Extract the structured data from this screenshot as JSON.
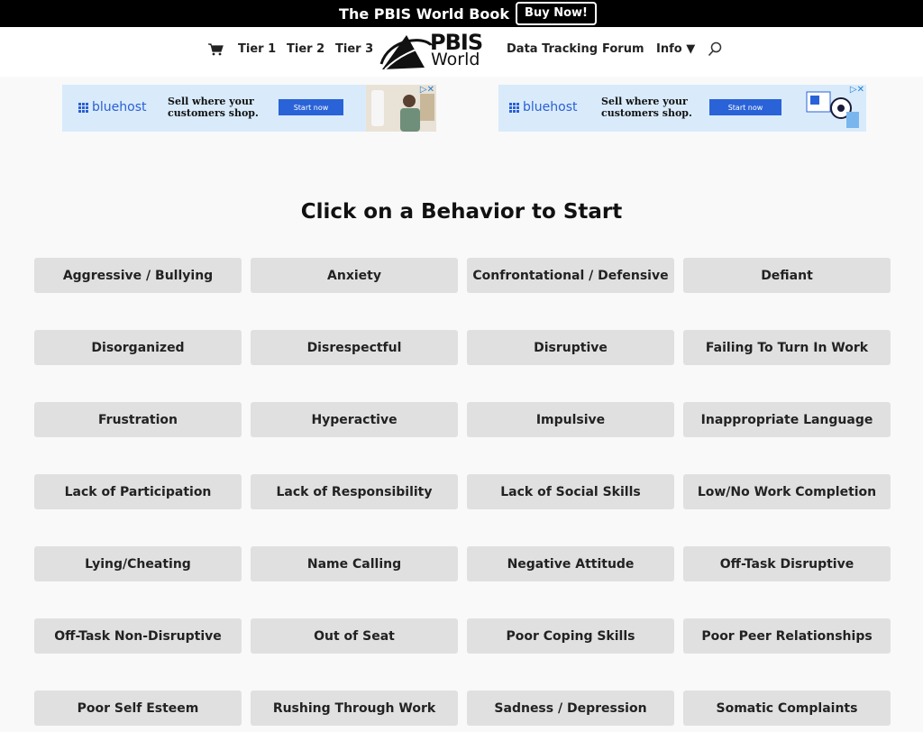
{
  "topbar": {
    "title": "The PBIS World Book",
    "button": "Buy Now!"
  },
  "nav": {
    "tier1": "Tier 1",
    "tier2": "Tier 2",
    "tier3": "Tier 3",
    "logo_line1": "PBIS",
    "logo_line2": "World",
    "data_tracking": "Data Tracking",
    "forum": "Forum",
    "info": "Info ▼",
    "icons": [
      "cart-icon",
      "search-icon"
    ]
  },
  "ads": [
    {
      "brand": "bluehost",
      "line1": "Sell where your",
      "line2": "customers shop.",
      "cta": "Start now"
    },
    {
      "brand": "bluehost",
      "line1": "Sell where your",
      "line2": "customers shop.",
      "cta": "Start now"
    }
  ],
  "heading": "Click on a Behavior to Start",
  "behaviors": [
    "Aggressive / Bullying",
    "Anxiety",
    "Confrontational / Defensive",
    "Defiant",
    "Disorganized",
    "Disrespectful",
    "Disruptive",
    "Failing To Turn In Work",
    "Frustration",
    "Hyperactive",
    "Impulsive",
    "Inappropriate Language",
    "Lack of Participation",
    "Lack of Responsibility",
    "Lack of Social Skills",
    "Low/No Work Completion",
    "Lying/Cheating",
    "Name Calling",
    "Negative Attitude",
    "Off-Task Disruptive",
    "Off-Task Non-Disruptive",
    "Out of Seat",
    "Poor Coping Skills",
    "Poor Peer Relationships",
    "Poor Self Esteem",
    "Rushing Through Work",
    "Sadness / Depression",
    "Somatic Complaints"
  ],
  "colors": {
    "topbar": "#000000",
    "button_bg": "#e0e0e0",
    "ad_bg": "#d9ebfb",
    "ad_accent": "#2a63d8"
  }
}
